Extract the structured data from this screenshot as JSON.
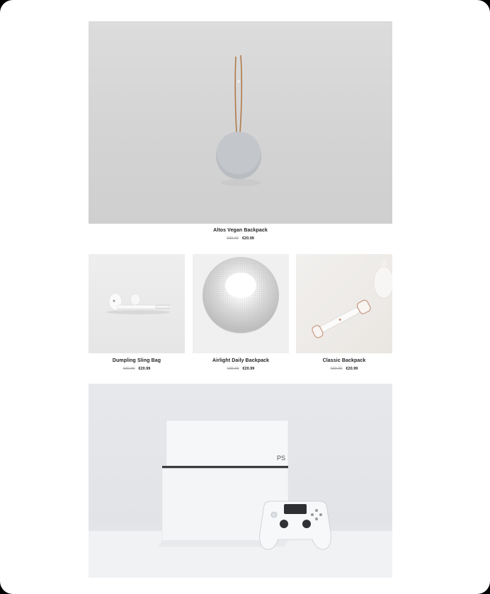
{
  "products": [
    {
      "title": "Altos Vegan Backpack",
      "old_price": "€30.99",
      "price": "€20.99",
      "image": "hanging-speaker"
    },
    {
      "title": "Dumpling Sling Bag",
      "old_price": "€30.99",
      "price": "€20.99",
      "image": "earbuds"
    },
    {
      "title": "Airlight Daily Backpack",
      "old_price": "€30.99",
      "price": "€20.99",
      "image": "smart-speaker"
    },
    {
      "title": "Classic Backpack",
      "old_price": "€30.99",
      "price": "€20.99",
      "image": "face-roller"
    },
    {
      "title": "",
      "old_price": "",
      "price": "",
      "image": "game-console"
    }
  ]
}
